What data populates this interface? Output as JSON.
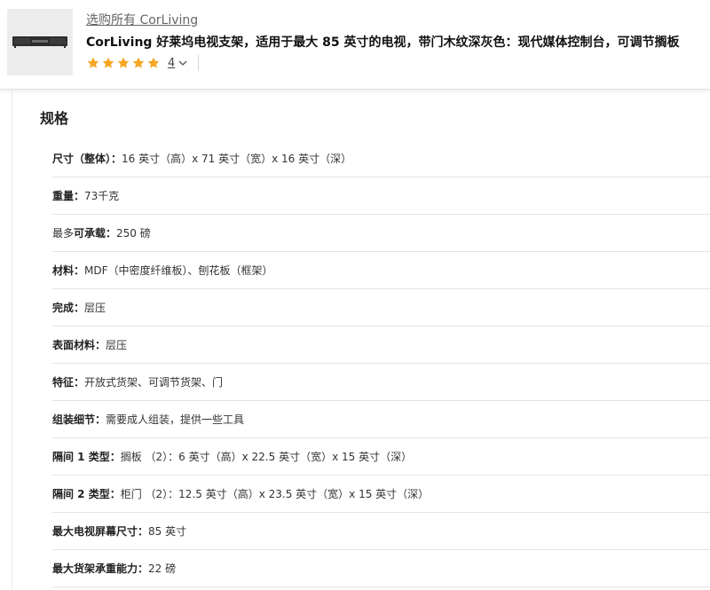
{
  "header": {
    "brand_link": "选购所有 CorLiving",
    "product_title": "CorLiving 好莱坞电视支架，适用于最大 85 英寸的电视，带门木纹深灰色：现代媒体控制台，可调节搁板",
    "rating": {
      "stars": 5,
      "star_color": "#f5a623",
      "count": "4"
    }
  },
  "specs": {
    "title": "规格",
    "rows": [
      {
        "key": "尺寸（整体）：",
        "value": "16 英寸（高）x 71 英寸（宽）x 16 英寸（深）"
      },
      {
        "key": "重量：",
        "value": "73千克"
      },
      {
        "prefix": "最多",
        "key": "可承载：",
        "value": "250 磅"
      },
      {
        "key": "材料：",
        "value": "MDF（中密度纤维板）、刨花板（框架）"
      },
      {
        "key": "完成：",
        "value": "层压"
      },
      {
        "key": "表面材料：",
        "value": "层压"
      },
      {
        "key": "特征：",
        "value": "开放式货架、可调节货架、门"
      },
      {
        "key": "组装细节：",
        "value": "需要成人组装，提供一些工具"
      },
      {
        "key": "隔间 1 类型：",
        "value": "搁板 （2）：6 英寸（高）x 22.5 英寸（宽）x 15 英寸（深）"
      },
      {
        "key": "隔间 2 类型：",
        "value": "柜门 （2）：12.5 英寸（高）x 23.5 英寸（宽）x 15 英寸（深）"
      },
      {
        "key": "最大电视屏幕尺寸：",
        "value": "85 英寸"
      },
      {
        "key": "最大货架承重能力：",
        "value": "22 磅"
      }
    ]
  }
}
